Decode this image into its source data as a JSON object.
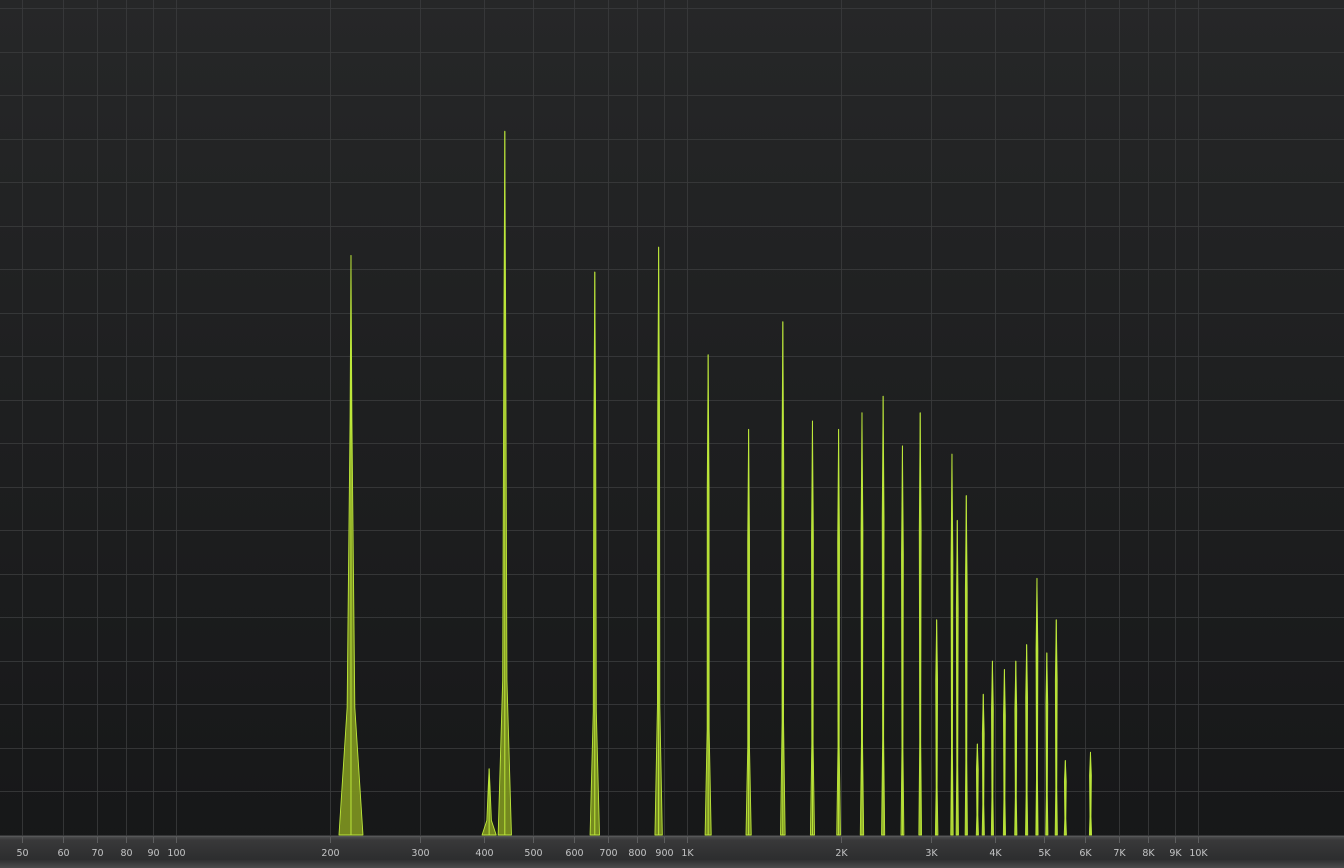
{
  "window": {
    "title": ""
  },
  "analyzer": {
    "name": "spectrum-analyzer",
    "colors": {
      "background": "#1d1e1f",
      "grid": "#3a3b3c",
      "spectrum_fill": "#7e9420",
      "spectrum_line": "#bde83a",
      "axis_bar": "#333435",
      "axis_text": "#c3c4c5"
    }
  },
  "chart_data": {
    "type": "area",
    "title": "",
    "xlabel": "",
    "ylabel": "",
    "x_scale": "log",
    "xlim": [
      45,
      20000
    ],
    "ylim": [
      0,
      1
    ],
    "grid": true,
    "legend": "none",
    "x_tick_labels": [
      {
        "value": 50,
        "label": "50"
      },
      {
        "value": 60,
        "label": "60"
      },
      {
        "value": 70,
        "label": "70"
      },
      {
        "value": 80,
        "label": "80"
      },
      {
        "value": 90,
        "label": "90"
      },
      {
        "value": 100,
        "label": "100"
      },
      {
        "value": 200,
        "label": "200"
      },
      {
        "value": 300,
        "label": "300"
      },
      {
        "value": 400,
        "label": "400"
      },
      {
        "value": 500,
        "label": "500"
      },
      {
        "value": 600,
        "label": "600"
      },
      {
        "value": 700,
        "label": "700"
      },
      {
        "value": 800,
        "label": "800"
      },
      {
        "value": 900,
        "label": "900"
      },
      {
        "value": 1000,
        "label": "1K"
      },
      {
        "value": 2000,
        "label": "2K"
      },
      {
        "value": 3000,
        "label": "3K"
      },
      {
        "value": 4000,
        "label": "4K"
      },
      {
        "value": 5000,
        "label": "5K"
      },
      {
        "value": 6000,
        "label": "6K"
      },
      {
        "value": 7000,
        "label": "7K"
      },
      {
        "value": 8000,
        "label": "8K"
      },
      {
        "value": 9000,
        "label": "9K"
      },
      {
        "value": 10000,
        "label": "10K"
      }
    ],
    "series": [
      {
        "peaks": [
          {
            "freq": 220,
            "level": 0.7
          },
          {
            "freq": 410,
            "level": 0.08
          },
          {
            "freq": 440,
            "level": 0.85
          },
          {
            "freq": 660,
            "level": 0.68
          },
          {
            "freq": 880,
            "level": 0.71
          },
          {
            "freq": 1100,
            "level": 0.58
          },
          {
            "freq": 1320,
            "level": 0.49
          },
          {
            "freq": 1540,
            "level": 0.62
          },
          {
            "freq": 1760,
            "level": 0.5
          },
          {
            "freq": 1980,
            "level": 0.49
          },
          {
            "freq": 2200,
            "level": 0.51
          },
          {
            "freq": 2420,
            "level": 0.53
          },
          {
            "freq": 2640,
            "level": 0.47
          },
          {
            "freq": 2860,
            "level": 0.51
          },
          {
            "freq": 3080,
            "level": 0.26
          },
          {
            "freq": 3300,
            "level": 0.46
          },
          {
            "freq": 3380,
            "level": 0.38
          },
          {
            "freq": 3520,
            "level": 0.41
          },
          {
            "freq": 3700,
            "level": 0.11
          },
          {
            "freq": 3800,
            "level": 0.17
          },
          {
            "freq": 3960,
            "level": 0.21
          },
          {
            "freq": 4180,
            "level": 0.2
          },
          {
            "freq": 4400,
            "level": 0.21
          },
          {
            "freq": 4620,
            "level": 0.23
          },
          {
            "freq": 4840,
            "level": 0.31
          },
          {
            "freq": 5060,
            "level": 0.22
          },
          {
            "freq": 5280,
            "level": 0.26
          },
          {
            "freq": 5500,
            "level": 0.09
          },
          {
            "freq": 6160,
            "level": 0.1
          }
        ]
      }
    ]
  }
}
